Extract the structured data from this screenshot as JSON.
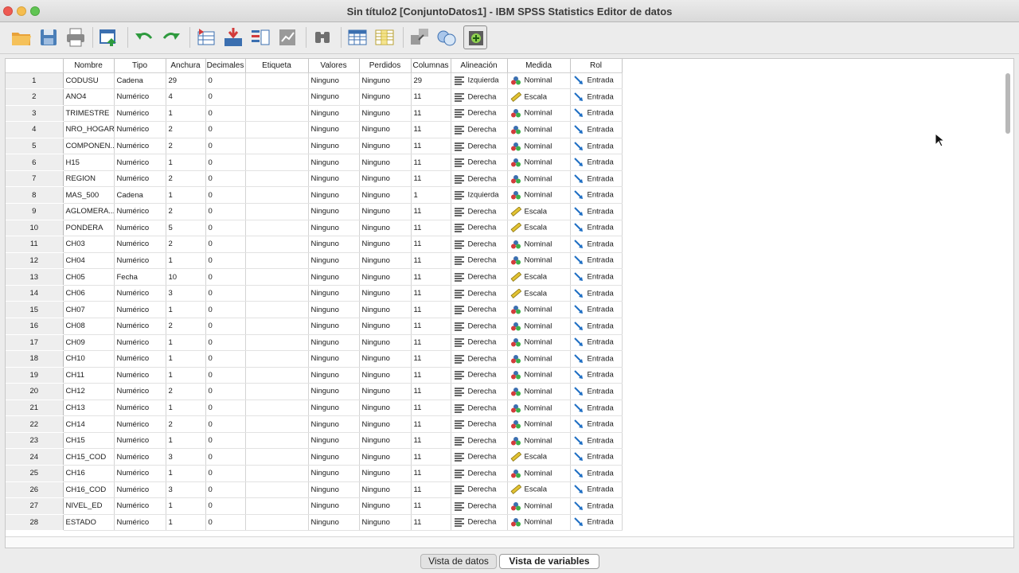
{
  "window": {
    "title": "Sin título2 [ConjuntoDatos1] - IBM SPSS Statistics Editor de datos"
  },
  "toolbar": {
    "buttons": [
      {
        "icon": "open-folder-icon"
      },
      {
        "icon": "save-icon"
      },
      {
        "icon": "print-icon"
      },
      {
        "icon": "recall-dialog-icon"
      },
      {
        "icon": "undo-icon"
      },
      {
        "icon": "redo-icon"
      },
      {
        "icon": "goto-case-icon"
      },
      {
        "icon": "goto-variable-icon"
      },
      {
        "icon": "variables-icon"
      },
      {
        "icon": "run-descriptives-icon"
      },
      {
        "icon": "find-icon"
      },
      {
        "icon": "insert-cases-icon"
      },
      {
        "icon": "insert-variable-icon"
      },
      {
        "icon": "split-file-icon"
      },
      {
        "icon": "value-labels-icon"
      },
      {
        "icon": "use-sets-icon"
      }
    ]
  },
  "grid": {
    "headers": [
      "",
      "Nombre",
      "Tipo",
      "Anchura",
      "Decimales",
      "Etiqueta",
      "Valores",
      "Perdidos",
      "Columnas",
      "Alineación",
      "Medida",
      "Rol"
    ],
    "rows": [
      {
        "n": "1",
        "nombre": "CODUSU",
        "tipo": "Cadena",
        "anchura": "29",
        "decimales": "0",
        "etiqueta": "",
        "valores": "Ninguno",
        "perdidos": "Ninguno",
        "columnas": "29",
        "alineacion": "Izquierda",
        "medida": "Nominal",
        "rol": "Entrada"
      },
      {
        "n": "2",
        "nombre": "ANO4",
        "tipo": "Numérico",
        "anchura": "4",
        "decimales": "0",
        "etiqueta": "",
        "valores": "Ninguno",
        "perdidos": "Ninguno",
        "columnas": "11",
        "alineacion": "Derecha",
        "medida": "Escala",
        "rol": "Entrada"
      },
      {
        "n": "3",
        "nombre": "TRIMESTRE",
        "tipo": "Numérico",
        "anchura": "1",
        "decimales": "0",
        "etiqueta": "",
        "valores": "Ninguno",
        "perdidos": "Ninguno",
        "columnas": "11",
        "alineacion": "Derecha",
        "medida": "Nominal",
        "rol": "Entrada"
      },
      {
        "n": "4",
        "nombre": "NRO_HOGAR",
        "tipo": "Numérico",
        "anchura": "2",
        "decimales": "0",
        "etiqueta": "",
        "valores": "Ninguno",
        "perdidos": "Ninguno",
        "columnas": "11",
        "alineacion": "Derecha",
        "medida": "Nominal",
        "rol": "Entrada"
      },
      {
        "n": "5",
        "nombre": "COMPONEN...",
        "tipo": "Numérico",
        "anchura": "2",
        "decimales": "0",
        "etiqueta": "",
        "valores": "Ninguno",
        "perdidos": "Ninguno",
        "columnas": "11",
        "alineacion": "Derecha",
        "medida": "Nominal",
        "rol": "Entrada"
      },
      {
        "n": "6",
        "nombre": "H15",
        "tipo": "Numérico",
        "anchura": "1",
        "decimales": "0",
        "etiqueta": "",
        "valores": "Ninguno",
        "perdidos": "Ninguno",
        "columnas": "11",
        "alineacion": "Derecha",
        "medida": "Nominal",
        "rol": "Entrada"
      },
      {
        "n": "7",
        "nombre": "REGION",
        "tipo": "Numérico",
        "anchura": "2",
        "decimales": "0",
        "etiqueta": "",
        "valores": "Ninguno",
        "perdidos": "Ninguno",
        "columnas": "11",
        "alineacion": "Derecha",
        "medida": "Nominal",
        "rol": "Entrada"
      },
      {
        "n": "8",
        "nombre": "MAS_500",
        "tipo": "Cadena",
        "anchura": "1",
        "decimales": "0",
        "etiqueta": "",
        "valores": "Ninguno",
        "perdidos": "Ninguno",
        "columnas": "1",
        "alineacion": "Izquierda",
        "medida": "Nominal",
        "rol": "Entrada"
      },
      {
        "n": "9",
        "nombre": "AGLOMERA...",
        "tipo": "Numérico",
        "anchura": "2",
        "decimales": "0",
        "etiqueta": "",
        "valores": "Ninguno",
        "perdidos": "Ninguno",
        "columnas": "11",
        "alineacion": "Derecha",
        "medida": "Escala",
        "rol": "Entrada"
      },
      {
        "n": "10",
        "nombre": "PONDERA",
        "tipo": "Numérico",
        "anchura": "5",
        "decimales": "0",
        "etiqueta": "",
        "valores": "Ninguno",
        "perdidos": "Ninguno",
        "columnas": "11",
        "alineacion": "Derecha",
        "medida": "Escala",
        "rol": "Entrada"
      },
      {
        "n": "11",
        "nombre": "CH03",
        "tipo": "Numérico",
        "anchura": "2",
        "decimales": "0",
        "etiqueta": "",
        "valores": "Ninguno",
        "perdidos": "Ninguno",
        "columnas": "11",
        "alineacion": "Derecha",
        "medida": "Nominal",
        "rol": "Entrada"
      },
      {
        "n": "12",
        "nombre": "CH04",
        "tipo": "Numérico",
        "anchura": "1",
        "decimales": "0",
        "etiqueta": "",
        "valores": "Ninguno",
        "perdidos": "Ninguno",
        "columnas": "11",
        "alineacion": "Derecha",
        "medida": "Nominal",
        "rol": "Entrada"
      },
      {
        "n": "13",
        "nombre": "CH05",
        "tipo": "Fecha",
        "anchura": "10",
        "decimales": "0",
        "etiqueta": "",
        "valores": "Ninguno",
        "perdidos": "Ninguno",
        "columnas": "11",
        "alineacion": "Derecha",
        "medida": "Escala",
        "rol": "Entrada"
      },
      {
        "n": "14",
        "nombre": "CH06",
        "tipo": "Numérico",
        "anchura": "3",
        "decimales": "0",
        "etiqueta": "",
        "valores": "Ninguno",
        "perdidos": "Ninguno",
        "columnas": "11",
        "alineacion": "Derecha",
        "medida": "Escala",
        "rol": "Entrada"
      },
      {
        "n": "15",
        "nombre": "CH07",
        "tipo": "Numérico",
        "anchura": "1",
        "decimales": "0",
        "etiqueta": "",
        "valores": "Ninguno",
        "perdidos": "Ninguno",
        "columnas": "11",
        "alineacion": "Derecha",
        "medida": "Nominal",
        "rol": "Entrada"
      },
      {
        "n": "16",
        "nombre": "CH08",
        "tipo": "Numérico",
        "anchura": "2",
        "decimales": "0",
        "etiqueta": "",
        "valores": "Ninguno",
        "perdidos": "Ninguno",
        "columnas": "11",
        "alineacion": "Derecha",
        "medida": "Nominal",
        "rol": "Entrada"
      },
      {
        "n": "17",
        "nombre": "CH09",
        "tipo": "Numérico",
        "anchura": "1",
        "decimales": "0",
        "etiqueta": "",
        "valores": "Ninguno",
        "perdidos": "Ninguno",
        "columnas": "11",
        "alineacion": "Derecha",
        "medida": "Nominal",
        "rol": "Entrada"
      },
      {
        "n": "18",
        "nombre": "CH10",
        "tipo": "Numérico",
        "anchura": "1",
        "decimales": "0",
        "etiqueta": "",
        "valores": "Ninguno",
        "perdidos": "Ninguno",
        "columnas": "11",
        "alineacion": "Derecha",
        "medida": "Nominal",
        "rol": "Entrada"
      },
      {
        "n": "19",
        "nombre": "CH11",
        "tipo": "Numérico",
        "anchura": "1",
        "decimales": "0",
        "etiqueta": "",
        "valores": "Ninguno",
        "perdidos": "Ninguno",
        "columnas": "11",
        "alineacion": "Derecha",
        "medida": "Nominal",
        "rol": "Entrada"
      },
      {
        "n": "20",
        "nombre": "CH12",
        "tipo": "Numérico",
        "anchura": "2",
        "decimales": "0",
        "etiqueta": "",
        "valores": "Ninguno",
        "perdidos": "Ninguno",
        "columnas": "11",
        "alineacion": "Derecha",
        "medida": "Nominal",
        "rol": "Entrada"
      },
      {
        "n": "21",
        "nombre": "CH13",
        "tipo": "Numérico",
        "anchura": "1",
        "decimales": "0",
        "etiqueta": "",
        "valores": "Ninguno",
        "perdidos": "Ninguno",
        "columnas": "11",
        "alineacion": "Derecha",
        "medida": "Nominal",
        "rol": "Entrada"
      },
      {
        "n": "22",
        "nombre": "CH14",
        "tipo": "Numérico",
        "anchura": "2",
        "decimales": "0",
        "etiqueta": "",
        "valores": "Ninguno",
        "perdidos": "Ninguno",
        "columnas": "11",
        "alineacion": "Derecha",
        "medida": "Nominal",
        "rol": "Entrada"
      },
      {
        "n": "23",
        "nombre": "CH15",
        "tipo": "Numérico",
        "anchura": "1",
        "decimales": "0",
        "etiqueta": "",
        "valores": "Ninguno",
        "perdidos": "Ninguno",
        "columnas": "11",
        "alineacion": "Derecha",
        "medida": "Nominal",
        "rol": "Entrada"
      },
      {
        "n": "24",
        "nombre": "CH15_COD",
        "tipo": "Numérico",
        "anchura": "3",
        "decimales": "0",
        "etiqueta": "",
        "valores": "Ninguno",
        "perdidos": "Ninguno",
        "columnas": "11",
        "alineacion": "Derecha",
        "medida": "Escala",
        "rol": "Entrada"
      },
      {
        "n": "25",
        "nombre": "CH16",
        "tipo": "Numérico",
        "anchura": "1",
        "decimales": "0",
        "etiqueta": "",
        "valores": "Ninguno",
        "perdidos": "Ninguno",
        "columnas": "11",
        "alineacion": "Derecha",
        "medida": "Nominal",
        "rol": "Entrada"
      },
      {
        "n": "26",
        "nombre": "CH16_COD",
        "tipo": "Numérico",
        "anchura": "3",
        "decimales": "0",
        "etiqueta": "",
        "valores": "Ninguno",
        "perdidos": "Ninguno",
        "columnas": "11",
        "alineacion": "Derecha",
        "medida": "Escala",
        "rol": "Entrada"
      },
      {
        "n": "27",
        "nombre": "NIVEL_ED",
        "tipo": "Numérico",
        "anchura": "1",
        "decimales": "0",
        "etiqueta": "",
        "valores": "Ninguno",
        "perdidos": "Ninguno",
        "columnas": "11",
        "alineacion": "Derecha",
        "medida": "Nominal",
        "rol": "Entrada"
      },
      {
        "n": "28",
        "nombre": "ESTADO",
        "tipo": "Numérico",
        "anchura": "1",
        "decimales": "0",
        "etiqueta": "",
        "valores": "Ninguno",
        "perdidos": "Ninguno",
        "columnas": "11",
        "alineacion": "Derecha",
        "medida": "Nominal",
        "rol": "Entrada"
      }
    ]
  },
  "tabs": {
    "data_view": "Vista de datos",
    "variable_view": "Vista de variables",
    "active": "variable_view"
  },
  "colors": {
    "accent_blue": "#1f6fc4",
    "nominal_red": "#d23b3b",
    "nominal_green": "#3fae4a",
    "scale_yellow": "#e2c232"
  }
}
